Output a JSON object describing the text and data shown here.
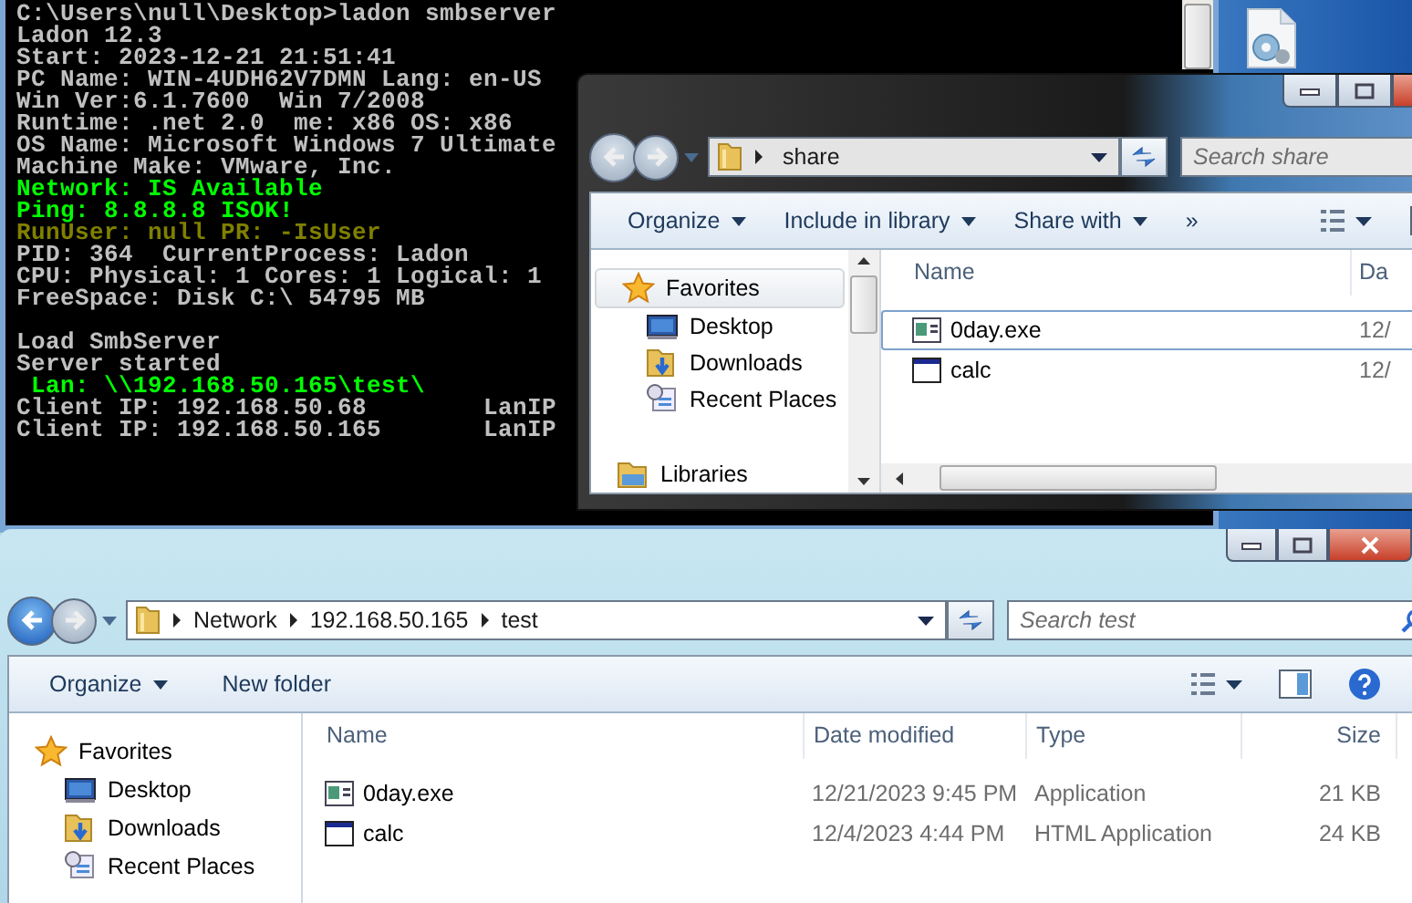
{
  "console": {
    "blocks": [
      {
        "lines": [
          {
            "text": "C:\\Users\\null\\Desktop>ladon smbserver",
            "color": "#c0c0c0"
          },
          {
            "text": "Ladon 12.3",
            "color": "#c0c0c0"
          },
          {
            "text": "Start: 2023-12-21 21:51:41",
            "color": "#c0c0c0"
          },
          {
            "text": "PC Name: WIN-4UDH62V7DMN Lang: en-US",
            "color": "#c0c0c0"
          },
          {
            "text": "Win Ver:6.1.7600  Win 7/2008",
            "color": "#c0c0c0"
          },
          {
            "text": "Runtime: .net 2.0  me: x86 OS: x86",
            "color": "#c0c0c0"
          },
          {
            "text": "OS Name: Microsoft Windows 7 Ultimate",
            "color": "#c0c0c0"
          },
          {
            "text": "Machine Make: VMware, Inc.",
            "color": "#c0c0c0"
          },
          {
            "text": "Network: IS Available",
            "color": "#00ff00"
          },
          {
            "text": "Ping: 8.8.8.8 ISOK!",
            "color": "#00ff00"
          },
          {
            "text": "RunUser: null PR: -IsUser",
            "color": "#808000"
          },
          {
            "text": "PID: 364  CurrentProcess: Ladon",
            "color": "#c0c0c0"
          },
          {
            "text": "CPU: Physical: 1 Cores: 1 Logical: 1",
            "color": "#c0c0c0"
          },
          {
            "text": "FreeSpace: Disk C:\\ 54795 MB",
            "color": "#c0c0c0"
          }
        ]
      },
      {
        "lines": [
          {
            "text": "Load SmbServer",
            "color": "#c0c0c0"
          },
          {
            "text": "Server started",
            "color": "#c0c0c0"
          },
          {
            "text": " Lan: \\\\192.168.50.165\\test\\",
            "color": "#00ff00"
          },
          {
            "text": "Client IP: 192.168.50.68        LanIP",
            "color": "#c0c0c0"
          },
          {
            "text": "Client IP: 192.168.50.165       LanIP",
            "color": "#c0c0c0"
          }
        ]
      }
    ]
  },
  "windows": [
    {
      "back_enabled": false,
      "address": [
        "share"
      ],
      "search": {
        "placeholder": "Search share"
      },
      "toolbar": [
        {
          "label": "Organize",
          "dropdown": true
        },
        {
          "label": "Include in library",
          "dropdown": true
        },
        {
          "label": "Share with",
          "dropdown": true
        },
        {
          "label": "»",
          "dropdown": false
        }
      ],
      "help": false,
      "nav": [
        {
          "label": "Favorites",
          "kind": "group",
          "selected": true
        },
        {
          "label": "Desktop",
          "kind": "item",
          "selected": false
        },
        {
          "label": "Downloads",
          "kind": "item",
          "selected": false
        },
        {
          "label": "Recent Places",
          "kind": "item",
          "selected": false
        },
        {
          "label": "Libraries",
          "kind": "group",
          "selected": false
        }
      ],
      "columns": [
        "Name",
        "Da"
      ],
      "rows": [
        {
          "cells": [
            "0day.exe",
            "12/"
          ],
          "selected": false,
          "focused": true
        },
        {
          "cells": [
            "calc",
            "12/"
          ],
          "selected": false,
          "focused": false
        }
      ]
    },
    {
      "back_enabled": true,
      "address": [
        "Network",
        "192.168.50.165",
        "test"
      ],
      "search": {
        "placeholder": "Search test"
      },
      "toolbar": [
        {
          "label": "Organize",
          "dropdown": true
        },
        {
          "label": "New folder",
          "dropdown": false
        }
      ],
      "help": true,
      "nav": [
        {
          "label": "Favorites",
          "kind": "group",
          "selected": false
        },
        {
          "label": "Desktop",
          "kind": "item",
          "selected": false
        },
        {
          "label": "Downloads",
          "kind": "item",
          "selected": false
        },
        {
          "label": "Recent Places",
          "kind": "item",
          "selected": false
        }
      ],
      "columns": [
        "Name",
        "Date modified",
        "Type",
        "Size"
      ],
      "rows": [
        {
          "cells": [
            "0day.exe",
            "12/21/2023 9:45 PM",
            "Application",
            "21 KB"
          ],
          "selected": false,
          "focused": false
        },
        {
          "cells": [
            "calc",
            "12/4/2023 4:44 PM",
            "HTML Application",
            "24 KB"
          ],
          "selected": false,
          "focused": false
        }
      ]
    }
  ]
}
